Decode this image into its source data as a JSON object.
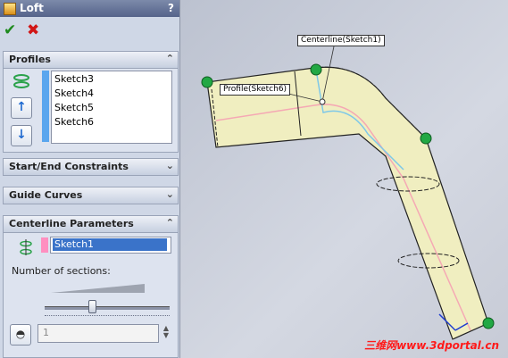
{
  "feature": {
    "title": "Loft",
    "help": "?"
  },
  "actions": {
    "ok_icon": "check-icon",
    "cancel_icon": "x-icon",
    "ok_glyph": "✔",
    "cancel_glyph": "✖"
  },
  "sections": {
    "profiles": {
      "title": "Profiles",
      "items": [
        "Sketch3",
        "Sketch4",
        "Sketch5",
        "Sketch6"
      ]
    },
    "start_end": {
      "title": "Start/End Constraints"
    },
    "guide_curves": {
      "title": "Guide Curves"
    },
    "centerline": {
      "title": "Centerline Parameters",
      "centerline_value": "Sketch1",
      "sections_label": "Number of sections:",
      "sections_value": "1"
    }
  },
  "graphics": {
    "callout_centerline": "Centerline(Sketch1)",
    "callout_profile": "Profile(Sketch6)",
    "watermark": "三维网www.3dportal.cn"
  },
  "colors": {
    "accent": "#3a73c9",
    "profile_bar": "#5aa6ee",
    "centerline_bar": "#ff8fc0",
    "handle": "#22a844",
    "body": "#f0eec0"
  }
}
